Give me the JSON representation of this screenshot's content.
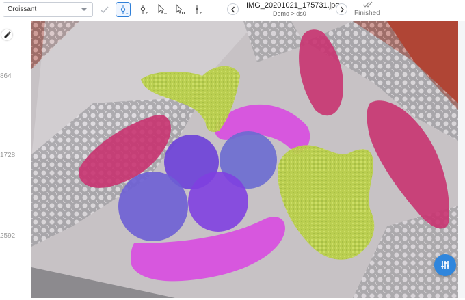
{
  "toolbar": {
    "label_select_value": "Croissant",
    "icons": [
      "chevron-down-icon",
      "check-icon",
      "keypoint-add-icon",
      "keypoint-add-icon",
      "pointer-remove-icon",
      "keypoint-select-icon",
      "keypoint-add-icon"
    ]
  },
  "image_nav": {
    "filename": "IMG_20201021_175731.jpg",
    "breadcrumb": "Demo > ds0"
  },
  "status": {
    "label": "Finished"
  },
  "ruler": {
    "ticks": [
      "864",
      "1728",
      "2592"
    ]
  },
  "colors": {
    "accent": "#2f86dd",
    "banana": "#d84ee0",
    "broccoli": "#b8d84a",
    "croissant": "#c8306e",
    "apple": "#6b54d8",
    "cloth": "#c9c3c7",
    "table": "#b04535"
  }
}
